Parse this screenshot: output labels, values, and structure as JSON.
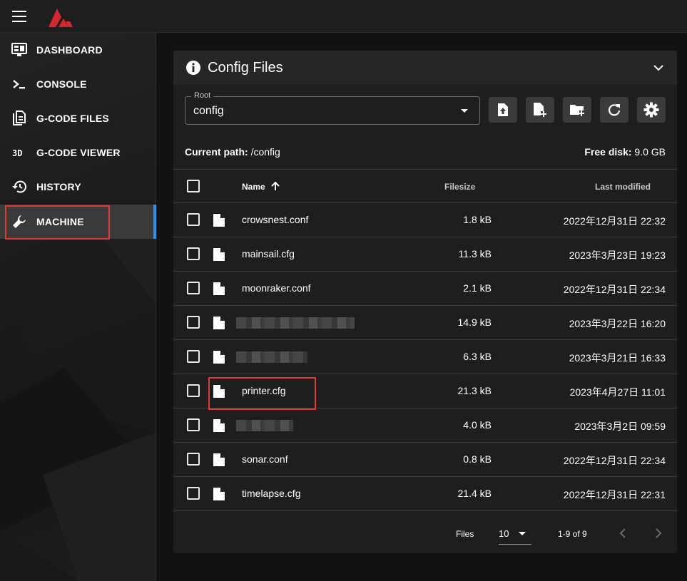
{
  "nav": {
    "items": [
      {
        "label": "DASHBOARD",
        "icon": "monitor-dashboard-icon"
      },
      {
        "label": "CONSOLE",
        "icon": "console-icon"
      },
      {
        "label": "G-CODE FILES",
        "icon": "file-document-icon"
      },
      {
        "label": "G-CODE VIEWER",
        "icon": "3d-viewer-icon"
      },
      {
        "label": "HISTORY",
        "icon": "history-icon"
      },
      {
        "label": "MACHINE",
        "icon": "wrench-icon"
      }
    ],
    "active": "MACHINE"
  },
  "card": {
    "title": "Config Files",
    "root": {
      "legend": "Root",
      "value": "config"
    },
    "toolbar": [
      "upload-file-icon",
      "new-file-icon",
      "new-folder-icon",
      "refresh-icon",
      "settings-gear-icon"
    ],
    "current_path_label": "Current path:",
    "current_path": "/config",
    "free_disk_label": "Free disk:",
    "free_disk": "9.0 GB",
    "columns": {
      "name": "Name",
      "filesize": "Filesize",
      "modified": "Last modified"
    },
    "rows": [
      {
        "name": "crowsnest.conf",
        "size": "1.8 kB",
        "modified": "2022年12月31日 22:32"
      },
      {
        "name": "mainsail.cfg",
        "size": "11.3 kB",
        "modified": "2023年3月23日 19:23"
      },
      {
        "name": "moonraker.conf",
        "size": "2.1 kB",
        "modified": "2022年12月31日 22:34"
      },
      {
        "name": "",
        "size": "14.9 kB",
        "modified": "2023年3月22日 16:20"
      },
      {
        "name": "",
        "size": "6.3 kB",
        "modified": "2023年3月21日 16:33"
      },
      {
        "name": "printer.cfg",
        "size": "21.3 kB",
        "modified": "2023年4月27日 11:01"
      },
      {
        "name": "",
        "size": "4.0 kB",
        "modified": "2023年3月2日 09:59"
      },
      {
        "name": "sonar.conf",
        "size": "0.8 kB",
        "modified": "2022年12月31日 22:34"
      },
      {
        "name": "timelapse.cfg",
        "size": "21.4 kB",
        "modified": "2022年12月31日 22:31"
      }
    ],
    "footer": {
      "label": "Files",
      "per_page": "10",
      "range": "1-9 of 9"
    }
  },
  "colors": {
    "accent": "#2196f3",
    "highlight": "#e53935",
    "logo": "#d7262d"
  }
}
